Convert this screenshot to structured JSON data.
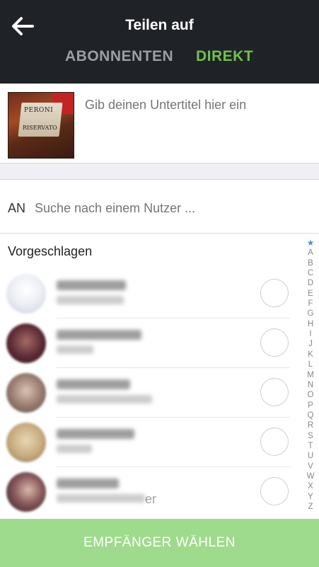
{
  "header": {
    "title": "Teilen auf",
    "tabs": [
      {
        "label": "ABONNENTEN",
        "active": false
      },
      {
        "label": "DIREKT",
        "active": true
      }
    ],
    "colors": {
      "background": "#1f2227",
      "active_tab": "#70c14b",
      "inactive_tab": "#9aa0a6"
    }
  },
  "compose": {
    "thumbnail": {
      "sign_line1": "PERONI",
      "sign_line2": "RISERVATO"
    },
    "caption_placeholder": "Gib deinen Untertitel hier ein"
  },
  "recipient": {
    "label": "AN",
    "search_placeholder": "Suche nach einem Nutzer ..."
  },
  "suggested": {
    "title": "Vorgeschlagen",
    "users": [
      {
        "name": "",
        "subtitle": "",
        "selected": false
      },
      {
        "name": "",
        "subtitle": "",
        "selected": false
      },
      {
        "name": "",
        "subtitle": "",
        "selected": false
      },
      {
        "name": "",
        "subtitle": "",
        "selected": false
      },
      {
        "name": "",
        "subtitle": "",
        "subtitle_visible_end": "er",
        "selected": false
      }
    ]
  },
  "index": {
    "star": "★",
    "letters": [
      "A",
      "B",
      "C",
      "D",
      "E",
      "F",
      "G",
      "H",
      "I",
      "J",
      "K",
      "L",
      "M",
      "N",
      "O",
      "P",
      "Q",
      "R",
      "S",
      "T",
      "U",
      "V",
      "W",
      "X",
      "Y",
      "Z"
    ]
  },
  "action_button": {
    "label": "EMPFÄNGER WÄHLEN",
    "color": "#9fdb8d"
  }
}
